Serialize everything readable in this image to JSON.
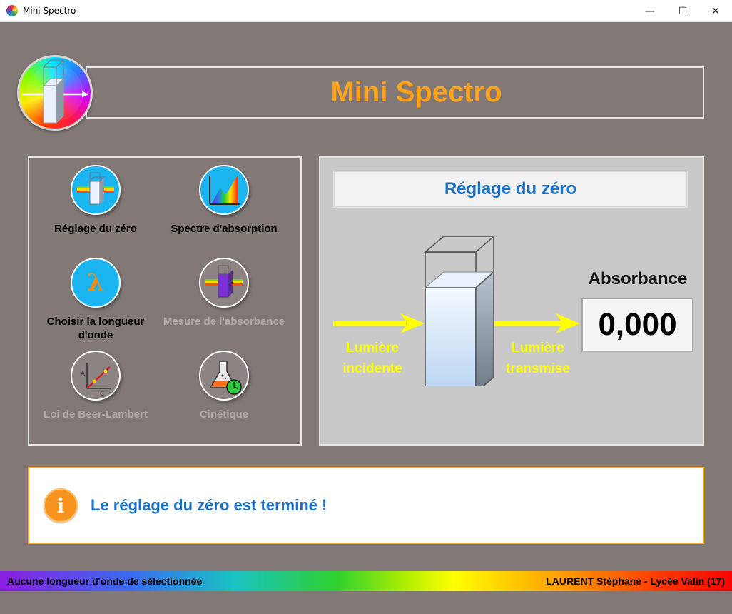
{
  "window": {
    "title": "Mini Spectro",
    "controls": {
      "minimize": "—",
      "maximize": "☐",
      "close": "✕"
    }
  },
  "header": {
    "title": "Mini Spectro"
  },
  "tools": [
    {
      "id": "zero",
      "label": "Réglage du zéro",
      "enabled": true,
      "icon": "cuvette-icon"
    },
    {
      "id": "spectrum",
      "label": "Spectre d'absorption",
      "enabled": true,
      "icon": "spectrum-icon"
    },
    {
      "id": "wavelength",
      "label": "Choisir la longueur d'onde",
      "enabled": true,
      "icon": "lambda-icon",
      "glyph": "λ"
    },
    {
      "id": "measure",
      "label": "Mesure de l'absorbance",
      "enabled": false,
      "icon": "measure-icon"
    },
    {
      "id": "beer",
      "label": "Loi de Beer-Lambert",
      "enabled": false,
      "icon": "beer-lambert-icon",
      "axis_a": "A",
      "axis_c": "C"
    },
    {
      "id": "kinetics",
      "label": "Cinétique",
      "enabled": false,
      "icon": "flask-clock-icon"
    }
  ],
  "panel": {
    "title": "Réglage du zéro",
    "incident_label_1": "Lumière",
    "incident_label_2": "incidente",
    "transmitted_label_1": "Lumière",
    "transmitted_label_2": "transmise",
    "absorbance_label": "Absorbance",
    "absorbance_value": "0,000"
  },
  "message": {
    "text": "Le réglage du zéro est terminé !",
    "icon_glyph": "i"
  },
  "status": {
    "left": "Aucune longueur d'onde de sélectionnée",
    "right": "LAURENT Stéphane - Lycée Valin (17)"
  },
  "colors": {
    "accent": "#ffa31a",
    "title_blue": "#1c72c4",
    "background": "#827977",
    "tool_active": "#1ab4f0",
    "light_beam": "#ffff00"
  }
}
